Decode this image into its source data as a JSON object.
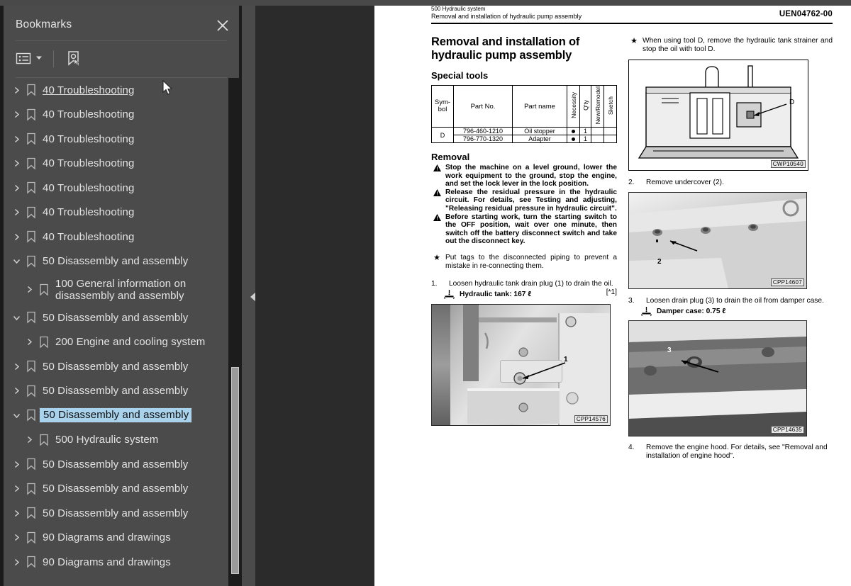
{
  "panel": {
    "title": "Bookmarks",
    "close_icon": "close-icon",
    "toolbar": {
      "options_icon": "bookmark-options-icon",
      "dropdown_icon": "chevron-down-icon",
      "new_bookmark_icon": "new-bookmark-icon"
    }
  },
  "tree": {
    "items": [
      {
        "label": "40 Troubleshooting",
        "level": 1,
        "expanded": false,
        "state": "hover"
      },
      {
        "label": "40 Troubleshooting",
        "level": 1,
        "expanded": false,
        "state": "normal"
      },
      {
        "label": "40 Troubleshooting",
        "level": 1,
        "expanded": false,
        "state": "normal"
      },
      {
        "label": "40 Troubleshooting",
        "level": 1,
        "expanded": false,
        "state": "normal"
      },
      {
        "label": "40 Troubleshooting",
        "level": 1,
        "expanded": false,
        "state": "normal"
      },
      {
        "label": "40 Troubleshooting",
        "level": 1,
        "expanded": false,
        "state": "normal"
      },
      {
        "label": "40 Troubleshooting",
        "level": 1,
        "expanded": false,
        "state": "normal"
      },
      {
        "label": "50 Disassembly and assembly",
        "level": 1,
        "expanded": true,
        "state": "normal"
      },
      {
        "label": "100 General information on disassembly and assembly",
        "level": 2,
        "expanded": false,
        "state": "normal",
        "two_line": true
      },
      {
        "label": "50 Disassembly and assembly",
        "level": 1,
        "expanded": true,
        "state": "normal"
      },
      {
        "label": "200 Engine and cooling system",
        "level": 2,
        "expanded": false,
        "state": "normal"
      },
      {
        "label": "50 Disassembly and assembly",
        "level": 1,
        "expanded": false,
        "state": "normal"
      },
      {
        "label": "50 Disassembly and assembly",
        "level": 1,
        "expanded": false,
        "state": "normal"
      },
      {
        "label": "50 Disassembly and assembly",
        "level": 1,
        "expanded": true,
        "state": "selected"
      },
      {
        "label": "500 Hydraulic system",
        "level": 2,
        "expanded": false,
        "state": "normal"
      },
      {
        "label": "50 Disassembly and assembly",
        "level": 1,
        "expanded": false,
        "state": "normal"
      },
      {
        "label": "50 Disassembly and assembly",
        "level": 1,
        "expanded": false,
        "state": "normal"
      },
      {
        "label": "50 Disassembly and assembly",
        "level": 1,
        "expanded": false,
        "state": "normal"
      },
      {
        "label": "90 Diagrams and drawings",
        "level": 1,
        "expanded": false,
        "state": "normal"
      },
      {
        "label": "90 Diagrams and drawings",
        "level": 1,
        "expanded": false,
        "state": "normal"
      }
    ]
  },
  "colors": {
    "panel_bg": "#4b4b4b",
    "selection": "#a9d2ec",
    "workspace_bg": "#2b2b2b",
    "page_bg": "#ffffff"
  },
  "document": {
    "header": {
      "section": "500 Hydraulic system",
      "subject": "Removal and installation of hydraulic pump assembly",
      "doc_code": "UEN04762-00"
    },
    "title": "Removal and installation of hydraulic pump assembly",
    "special_tools": {
      "heading": "Special tools",
      "columns": [
        "Sym-bol",
        "Part No.",
        "Part name",
        "Necessity",
        "Q'ty",
        "New/Remodel",
        "Sketch"
      ],
      "rows": [
        {
          "symbol": "D",
          "part_no": "796-460-1210",
          "part_name": "Oil stopper",
          "necessity": "●",
          "qty": "1",
          "new_remodel": "",
          "sketch": ""
        },
        {
          "symbol": "",
          "part_no": "796-770-1320",
          "part_name": "Adapter",
          "necessity": "●",
          "qty": "1",
          "new_remodel": "",
          "sketch": ""
        }
      ]
    },
    "removal": {
      "heading": "Removal",
      "warnings": [
        "Stop the machine on a level ground, lower the work equipment to the ground, stop the engine, and set the lock lever in the lock position.",
        "Release the residual pressure in the hydraulic circuit. For details, see Testing and adjusting, \"Releasing residual pressure in hydraulic circuit\".",
        "Before starting work, turn the starting switch to the OFF position, wait over one minute, then switch off the battery disconnect switch and take out the disconnect key."
      ],
      "note": "Put tags to the disconnected piping to prevent a mistake in re-connecting them.",
      "steps": [
        {
          "num": "1.",
          "text": "Loosen hydraulic tank drain plug (1) to drain the oil.",
          "ref": "[*1]",
          "capacity": "Hydraulic tank: 167 ℓ",
          "photo_code": "CPP14576",
          "photo_callout": "1"
        },
        {
          "num": "2.",
          "text": "Remove undercover (2).",
          "photo_code": "CPP14607",
          "photo_callout": "2"
        },
        {
          "num": "3.",
          "text": "Loosen drain plug (3) to drain the oil from damper case.",
          "capacity": "Damper case: 0.75 ℓ",
          "photo_code": "CPP14635",
          "photo_callout": "3"
        },
        {
          "num": "4.",
          "text": "Remove the engine hood. For details, see \"Removal and installation of engine hood\"."
        }
      ]
    },
    "right_note": {
      "marker": "★",
      "text": "When using tool D, remove the hydraulic tank strainer and stop the oil with tool D.",
      "figure_code": "CWP10540",
      "figure_callout": "D"
    }
  }
}
